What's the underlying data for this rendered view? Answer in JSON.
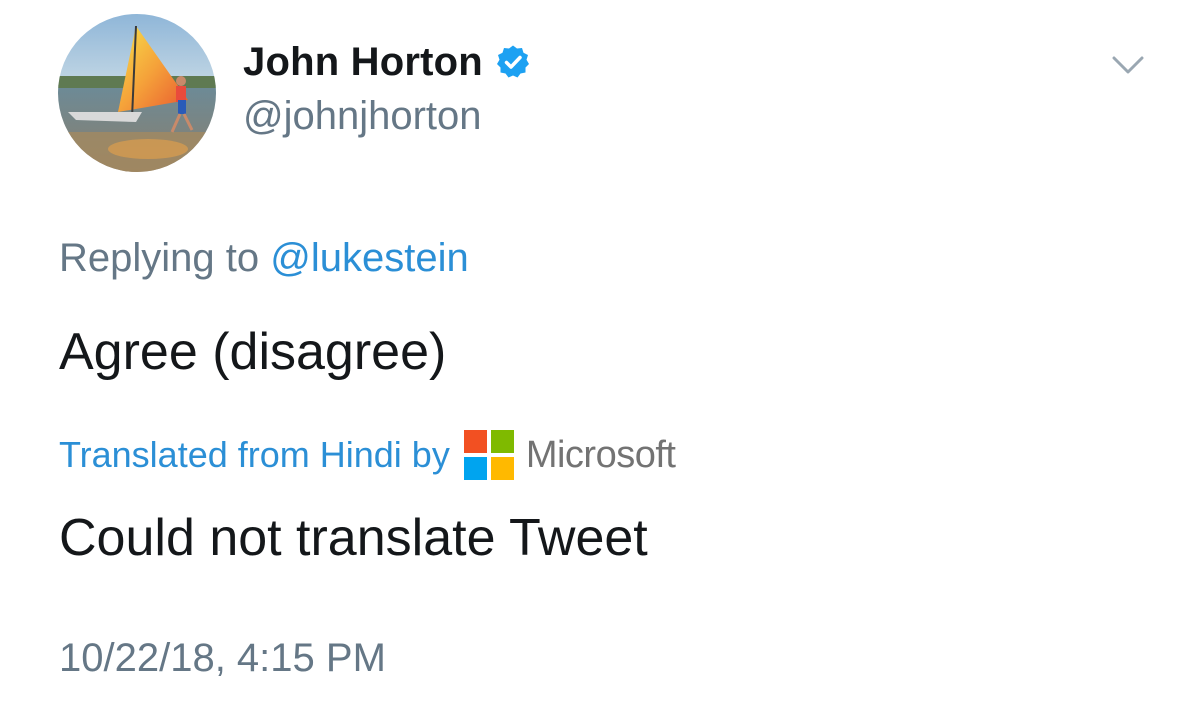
{
  "user": {
    "display_name": "John Horton",
    "handle": "@johnjhorton",
    "verified": true,
    "avatar_icon": "avatar-photo-sailboat"
  },
  "reply": {
    "prefix": "Replying to",
    "handle": "@lukestein"
  },
  "tweet": {
    "text": "Agree (disagree)",
    "timestamp": "10/22/18, 4:15 PM"
  },
  "translation": {
    "label": "Translated from Hindi by",
    "brand": "Microsoft",
    "result": "Could not translate Tweet"
  },
  "colors": {
    "link": "#2b8fd6",
    "secondary_text": "#657786",
    "primary_text": "#14171a",
    "verified_badge": "#1da1f2",
    "ms_red": "#f25022",
    "ms_green": "#7fba00",
    "ms_blue": "#00a4ef",
    "ms_yellow": "#ffb900"
  },
  "icons": {
    "verified": "verified-badge-icon",
    "more": "chevron-down-icon",
    "microsoft": "microsoft-logo-icon"
  }
}
